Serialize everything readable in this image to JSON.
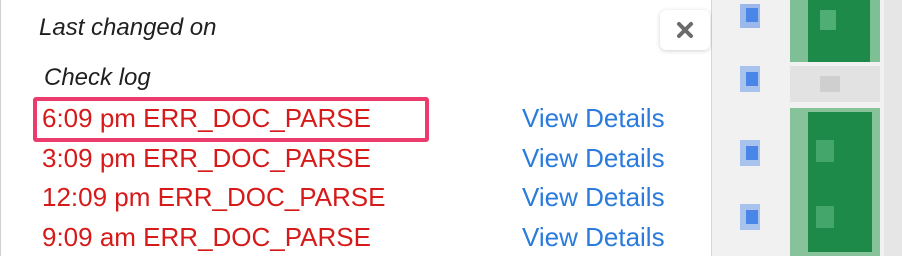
{
  "popup": {
    "last_changed_label": "Last changed on",
    "check_log_label": "Check log",
    "close_icon": "close-x-icon",
    "entries": [
      {
        "time": "6:09 pm",
        "code": "ERR_DOC_PARSE",
        "text": "6:09 pm ERR_DOC_PARSE",
        "link": "View Details"
      },
      {
        "time": "3:09 pm",
        "code": "ERR_DOC_PARSE",
        "text": "3:09 pm ERR_DOC_PARSE",
        "link": "View Details"
      },
      {
        "time": "12:09 pm",
        "code": "ERR_DOC_PARSE",
        "text": "12:09 pm ERR_DOC_PARSE",
        "link": "View Details"
      },
      {
        "time": "9:09 am",
        "code": "ERR_DOC_PARSE",
        "text": "9:09 am ERR_DOC_PARSE",
        "link": "View Details"
      }
    ]
  },
  "colors": {
    "error_text": "#d61a1a",
    "link_text": "#2a7bdc",
    "highlight_border": "#ec3c6e",
    "background_green": "#1e8a4a",
    "background_blue": "#4a86e8"
  }
}
